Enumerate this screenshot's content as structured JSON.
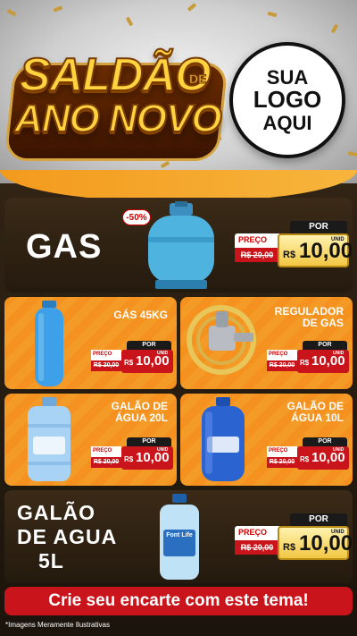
{
  "header": {
    "title_line1": "SALDÃO",
    "title_de": "DE",
    "title_line2": "ANO NOVO",
    "logo": {
      "line1": "SUA",
      "line2": "LOGO",
      "line3": "AQUI"
    }
  },
  "featured": {
    "name": "GAS",
    "discount_badge": "-50%",
    "por_label": "POR",
    "preco_label": "PREÇO",
    "old_price": "R$ 20,00",
    "currency": "R$",
    "price": "10,00",
    "unit": "UNID"
  },
  "products": [
    {
      "name_line1": "GÁS 45KG",
      "name_line2": "",
      "por_label": "POR",
      "preco_label": "PREÇO",
      "old_price": "R$ 20,00",
      "currency": "R$",
      "price": "10,00",
      "unit": "UNID"
    },
    {
      "name_line1": "REGULADOR",
      "name_line2": "DE GAS",
      "por_label": "POR",
      "preco_label": "PREÇO",
      "old_price": "R$ 20,00",
      "currency": "R$",
      "price": "10,00",
      "unit": "UNID"
    },
    {
      "name_line1": "GALÃO DE",
      "name_line2": "ÁGUA 20L",
      "por_label": "POR",
      "preco_label": "PREÇO",
      "old_price": "R$ 20,00",
      "currency": "R$",
      "price": "10,00",
      "unit": "UNID"
    },
    {
      "name_line1": "GALÃO DE",
      "name_line2": "ÁGUA 10L",
      "por_label": "POR",
      "preco_label": "PREÇO",
      "old_price": "R$ 20,00",
      "currency": "R$",
      "price": "10,00",
      "unit": "UNID"
    }
  ],
  "bottom_feature": {
    "name_line1": "GALÃO",
    "name_line2": "DE AGUA",
    "name_line3": "5L",
    "bottle_label": "Font Life",
    "por_label": "POR",
    "preco_label": "PREÇO",
    "old_price": "R$ 20,00",
    "currency": "R$",
    "price": "10,00",
    "unit": "UNID"
  },
  "cta": "Crie seu encarte com este tema!",
  "footnote": "*Imagens Meramente Ilustrativas",
  "colors": {
    "orange": "#f5911f",
    "red": "#c8141a",
    "dark": "#2e2112",
    "gold": "#f2c743"
  }
}
